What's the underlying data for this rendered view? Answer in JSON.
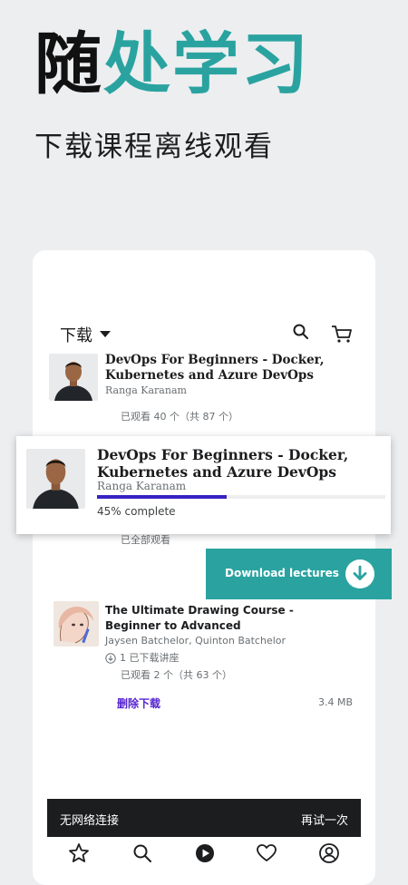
{
  "hero": {
    "title_part1": "随",
    "title_part2": "处学习",
    "subtitle": "下载课程离线观看"
  },
  "header": {
    "title": "下载",
    "search_icon": "search-icon",
    "cart_icon": "cart-icon"
  },
  "courses": [
    {
      "title": "DevOps For Beginners - Docker, Kubernetes and Azure DevOps",
      "instructor": "Ranga Karanam",
      "watched": "已观看 40 个（共 87 个）"
    },
    {
      "watched_status": "已全部观看"
    },
    {
      "title": "The Ultimate Drawing Course - Beginner to Advanced",
      "instructor": "Jaysen Batchelor, Quinton Batchelor",
      "downloaded": "1 已下载讲座",
      "watched": "已观看 2 个（共 63 个）",
      "delete_label": "删除下载",
      "size": "3.4 MB"
    }
  ],
  "floating_card": {
    "title": "DevOps For Beginners - Docker, Kubernetes and Azure DevOps",
    "instructor": "Ranga Karanam",
    "progress_text": "45% complete",
    "progress": 0.45
  },
  "download_button": {
    "label": "Download lectures",
    "icon": "download-arrow-icon"
  },
  "snackbar": {
    "message": "无网络连接",
    "action": "再试一次"
  },
  "bottom_nav": [
    "star-icon",
    "search-icon",
    "play-icon",
    "heart-icon",
    "account-icon"
  ],
  "colors": {
    "accent_teal": "#2aa3a0",
    "progress_purple": "#3723c2",
    "link_purple": "#5624d0"
  }
}
